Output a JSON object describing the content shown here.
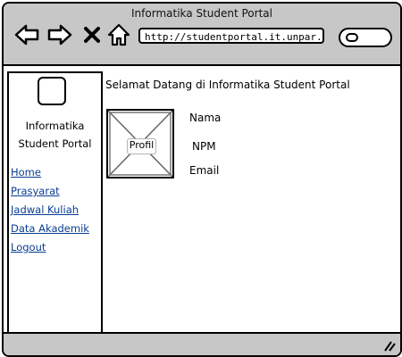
{
  "window": {
    "title": "Informatika Student Portal",
    "url": "http://studentportal.it.unpar.ac.id"
  },
  "toolbar": {
    "icons": [
      "arrow-left-icon",
      "arrow-right-icon",
      "close-icon",
      "home-icon",
      "search-icon"
    ]
  },
  "sidebar": {
    "logo_icon": "logo-icon",
    "brand": "Informatika Student Portal",
    "items": [
      {
        "label": "Home"
      },
      {
        "label": "Prasyarat"
      },
      {
        "label": "Jadwal Kuliah"
      },
      {
        "label": "Data Akademik"
      },
      {
        "label": "Logout"
      }
    ]
  },
  "main": {
    "welcome": "Selamat Datang di Informatika Student Portal",
    "profile_label": "Profil",
    "fields": {
      "name": "Nama",
      "npm": "NPM",
      "email": "Email"
    }
  },
  "colors": {
    "chrome": "#c7c7c7",
    "link": "#0a3d91",
    "border": "#000000"
  }
}
